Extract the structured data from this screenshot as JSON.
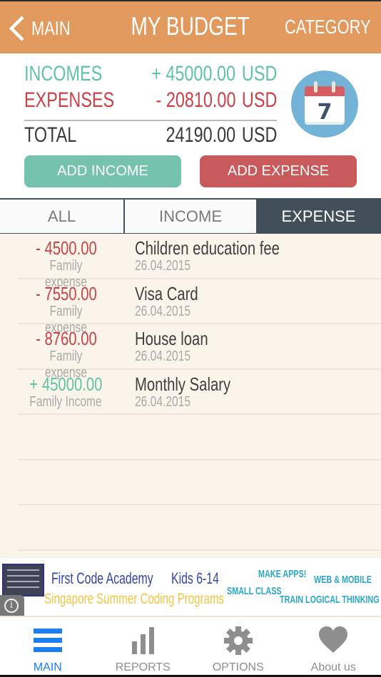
{
  "header": {
    "back_label": "MAIN",
    "title": "MY BUDGET",
    "right_label": "CATEGORY"
  },
  "summary": {
    "incomes_label": "INCOMES",
    "incomes_amount": "+ 45000.00",
    "incomes_currency": "USD",
    "expenses_label": "EXPENSES",
    "expenses_amount": "- 20810.00",
    "expenses_currency": "USD",
    "total_label": "TOTAL",
    "total_amount": "24190.00",
    "total_currency": "USD",
    "calendar_day": "7",
    "add_income_label": "ADD INCOME",
    "add_expense_label": "ADD EXPENSE"
  },
  "tabs": [
    {
      "label": "ALL",
      "active": false
    },
    {
      "label": "INCOME",
      "active": false
    },
    {
      "label": "EXPENSE",
      "active": true
    }
  ],
  "transactions": [
    {
      "amount": "- 4500.00",
      "type": "expense",
      "category": "Family expense",
      "name": "Children education fee",
      "date": "26.04.2015"
    },
    {
      "amount": "- 7550.00",
      "type": "expense",
      "category": "Family expense",
      "name": "Visa Card",
      "date": "26.04.2015"
    },
    {
      "amount": "- 8760.00",
      "type": "expense",
      "category": "Family expense",
      "name": "House loan",
      "date": "26.04.2015"
    },
    {
      "amount": "+ 45000.00",
      "type": "income",
      "category": "Family Income",
      "name": "Monthly Salary",
      "date": "26.04.2015"
    }
  ],
  "ad": {
    "title": "First Code Academy",
    "kids": "Kids 6-14",
    "subtitle": "Singapore Summer Coding Programs",
    "tag1": "MAKE APPS!",
    "tag2": "WEB & MOBILE",
    "tag3": "SMALL CLASS",
    "tag4": "TRAIN LOGICAL THINKING",
    "info_icon": "i"
  },
  "nav": [
    {
      "label": "MAIN",
      "icon": "menu-icon",
      "active": true
    },
    {
      "label": "REPORTS",
      "icon": "bar-chart-icon",
      "active": false
    },
    {
      "label": "OPTIONS",
      "icon": "gear-icon",
      "active": false
    },
    {
      "label": "About us",
      "icon": "heart-icon",
      "active": false
    }
  ],
  "colors": {
    "header": "#e1995e",
    "income": "#5fc3a4",
    "expense": "#cc4148",
    "active_tab": "#414f5b",
    "nav_active": "#1a7ff3"
  }
}
